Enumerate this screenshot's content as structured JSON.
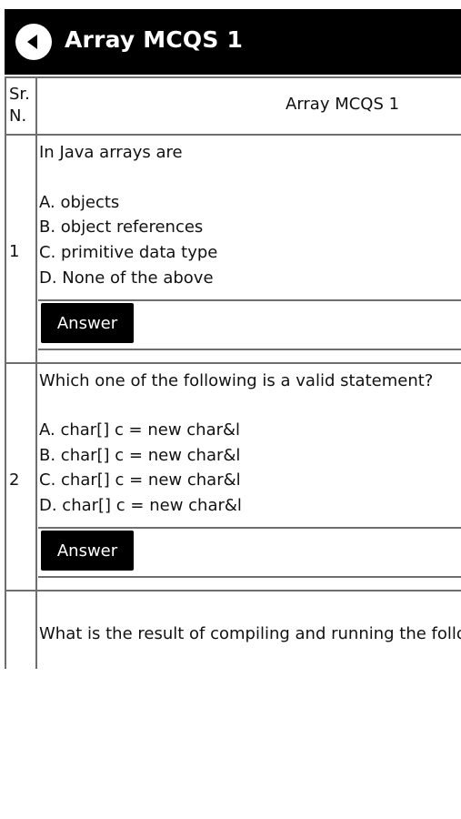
{
  "header": {
    "title": "Array MCQS 1"
  },
  "table": {
    "sr_header": "Sr. N.",
    "col_header": "Array MCQS 1",
    "rows": [
      {
        "num": "1",
        "question": "In Java arrays are",
        "options": [
          "A. objects",
          "B. object references",
          "C. primitive data type",
          "D. None of the above"
        ],
        "answer_label": "Answer"
      },
      {
        "num": "2",
        "question": "Which one of the following is a valid statement?",
        "options": [
          "A. char[] c = new char&l",
          "B. char[] c = new char&l",
          "C. char[] c = new char&l",
          "D. char[] c = new char&l"
        ],
        "answer_label": "Answer"
      },
      {
        "num": "",
        "question": "What is the result of compiling and running the follov",
        "options": [],
        "answer_label": ""
      }
    ]
  }
}
